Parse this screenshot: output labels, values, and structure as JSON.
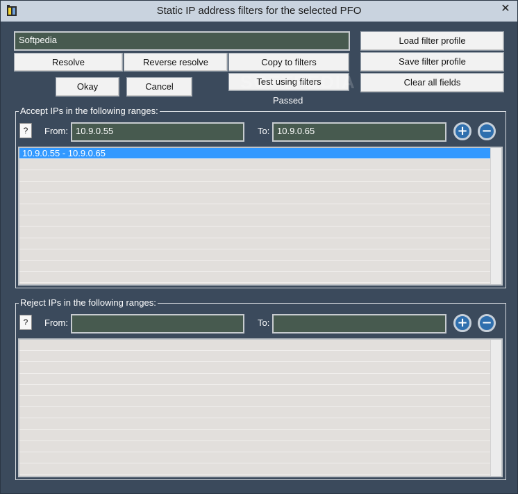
{
  "window": {
    "title": "Static IP address filters for the selected PFO",
    "close_glyph": "✕"
  },
  "top": {
    "name_value": "Softpedia",
    "resolve_label": "Resolve",
    "reverse_resolve_label": "Reverse resolve",
    "copy_to_filters_label": "Copy to filters",
    "test_using_filters_label": "Test using filters",
    "okay_label": "Okay",
    "cancel_label": "Cancel",
    "status_text": "Passed",
    "load_profile_label": "Load filter profile",
    "save_profile_label": "Save filter profile",
    "clear_fields_label": "Clear all fields",
    "watermark": "SOFTPEDIA"
  },
  "accept": {
    "group_title": "Accept IPs in the following ranges:",
    "help_label": "?",
    "from_label": "From:",
    "from_value": "10.9.0.55",
    "to_label": "To:",
    "to_value": "10.9.0.65",
    "add_glyph": "+",
    "remove_glyph": "−",
    "ranges": [
      "10.9.0.55 - 10.9.0.65"
    ]
  },
  "reject": {
    "group_title": "Reject IPs in the following ranges:",
    "help_label": "?",
    "from_label": "From:",
    "from_value": "",
    "to_label": "To:",
    "to_value": "",
    "add_glyph": "+",
    "remove_glyph": "−",
    "ranges": []
  },
  "colors": {
    "window_bg": "#3b4a5c",
    "field_bg": "#475a4f",
    "selection": "#3399ff",
    "list_bg": "#e2dfdc"
  },
  "icons": {
    "app": "app-icon",
    "close": "close-icon",
    "add": "plus-circle-icon",
    "remove": "minus-circle-icon"
  }
}
